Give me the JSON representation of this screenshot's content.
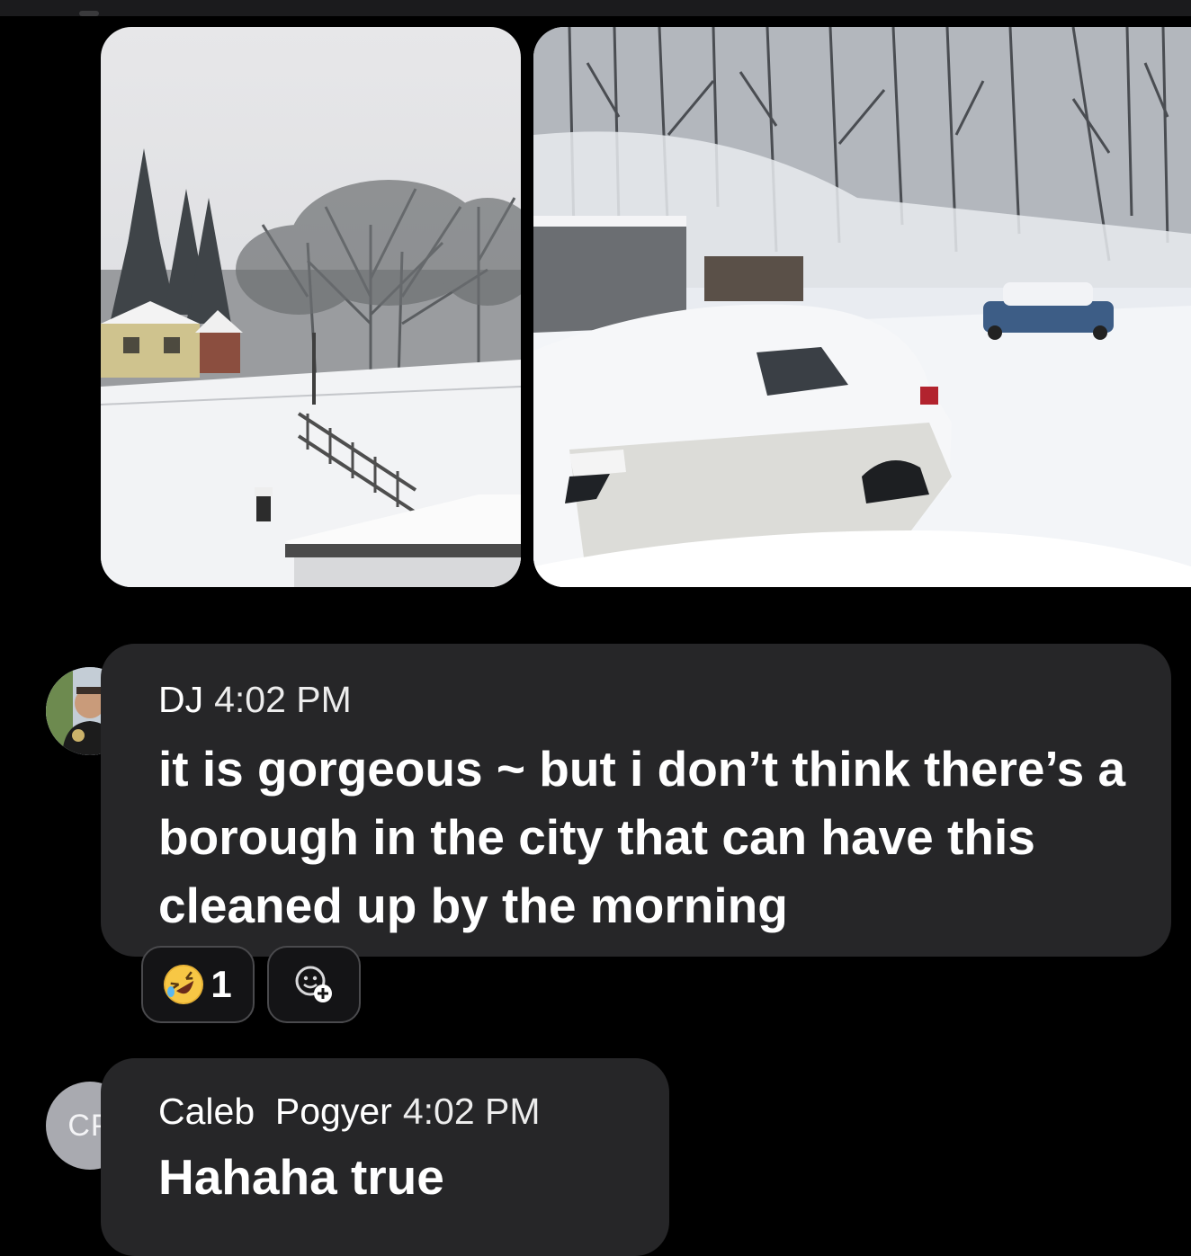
{
  "messages": [
    {
      "sender": "DJ",
      "time": "4:02 PM",
      "text": "it is gorgeous ~ but i don’t think there’s a borough in the city that can have this cleaned up by the morning",
      "avatar_icon": "profile-photo",
      "reactions": [
        {
          "emoji": "rolling-on-floor-laughing",
          "count": "1"
        }
      ],
      "add_reaction_icon": "add-reaction-icon"
    },
    {
      "sender": "Caleb  Pogyer",
      "time": "4:02 PM",
      "text": "Hahaha true",
      "avatar_initials": "CP"
    }
  ],
  "attachments": [
    {
      "icon": "photo-snowy-yard-house"
    },
    {
      "icon": "photo-snow-covered-car"
    }
  ],
  "colors": {
    "background": "#000000",
    "bubble": "#262628",
    "text": "#ffffff",
    "reaction_border": "#4a4a4d"
  }
}
